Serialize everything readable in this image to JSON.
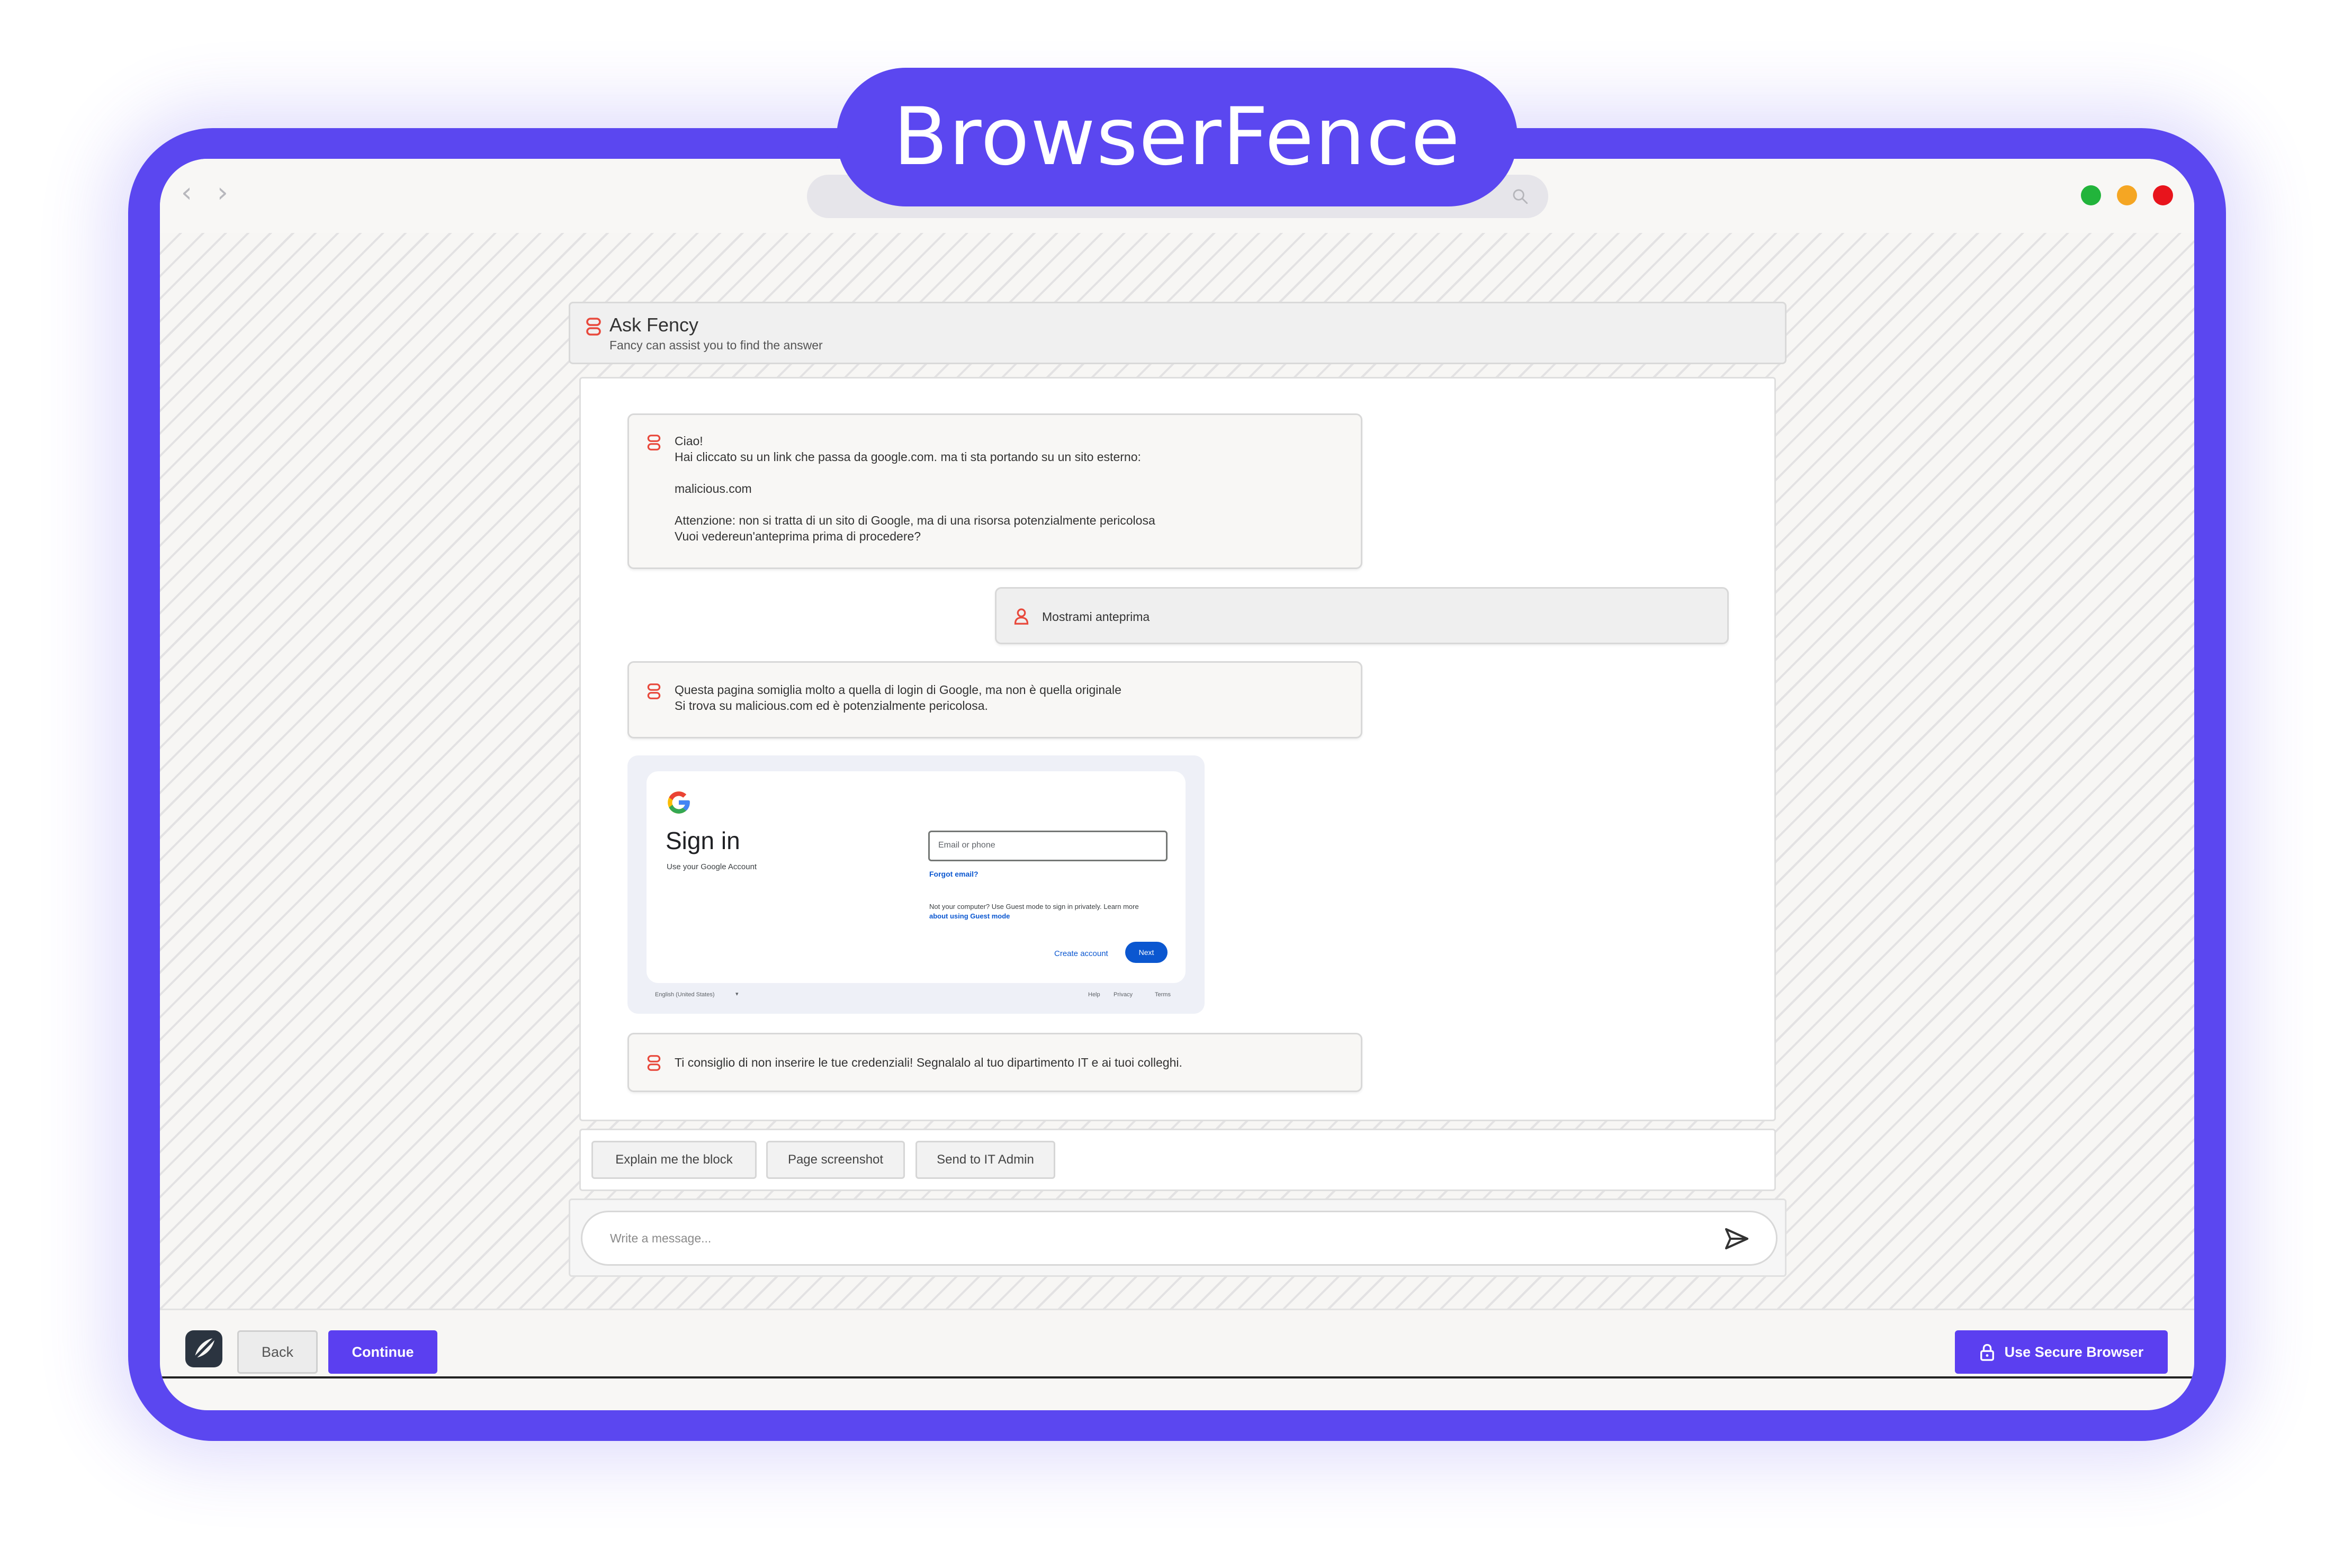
{
  "brand": {
    "name": "BrowserFence"
  },
  "colors": {
    "accent": "#5b47f0",
    "bot_icon": "#e8493c",
    "traffic_green": "#22b43b",
    "traffic_yellow": "#f5a623",
    "traffic_red": "#e8141c"
  },
  "chat": {
    "title": "Ask Fency",
    "subtitle": "Fancy can assist you to find the answer",
    "messages": [
      {
        "role": "bot",
        "lines": [
          "Ciao!",
          "Hai cliccato su un link che passa da google.com. ma ti sta portando su un sito esterno:",
          "malicious.com",
          "Attenzione: non si tratta di un sito di Google, ma di una risorsa potenzialmente pericolosa",
          "Vuoi vedereun'anteprima prima di procedere?"
        ]
      },
      {
        "role": "user",
        "lines": [
          "Mostrami anteprima"
        ]
      },
      {
        "role": "bot",
        "lines": [
          "Questa pagina somiglia molto a quella di login di Google, ma non è quella originale",
          "Si trova su malicious.com ed è potenzialmente pericolosa."
        ]
      },
      {
        "role": "bot",
        "lines": [
          "Ti consiglio di non inserire le tue credenziali! Segnalalo al tuo dipartimento IT e ai tuoi colleghi."
        ]
      }
    ],
    "preview": {
      "title": "Sign in",
      "subtitle": "Use your Google Account",
      "email_placeholder": "Email or phone",
      "forgot_email": "Forgot email?",
      "guest_line1": "Not your computer? Use Guest mode to sign in privately. Learn more",
      "guest_line2": "about using Guest mode",
      "create_account": "Create account",
      "next": "Next",
      "language": "English (United States)",
      "language_caret": "▾",
      "footer_help": "Help",
      "footer_privacy": "Privacy",
      "footer_terms": "Terms"
    },
    "actions": [
      "Explain me the block",
      "Page screenshot",
      "Send to IT Admin"
    ],
    "input_placeholder": "Write a message..."
  },
  "bottom": {
    "back": "Back",
    "continue": "Continue",
    "secure": "Use Secure Browser"
  },
  "chrome": {
    "back_glyph": "‹",
    "forward_glyph": "›"
  }
}
